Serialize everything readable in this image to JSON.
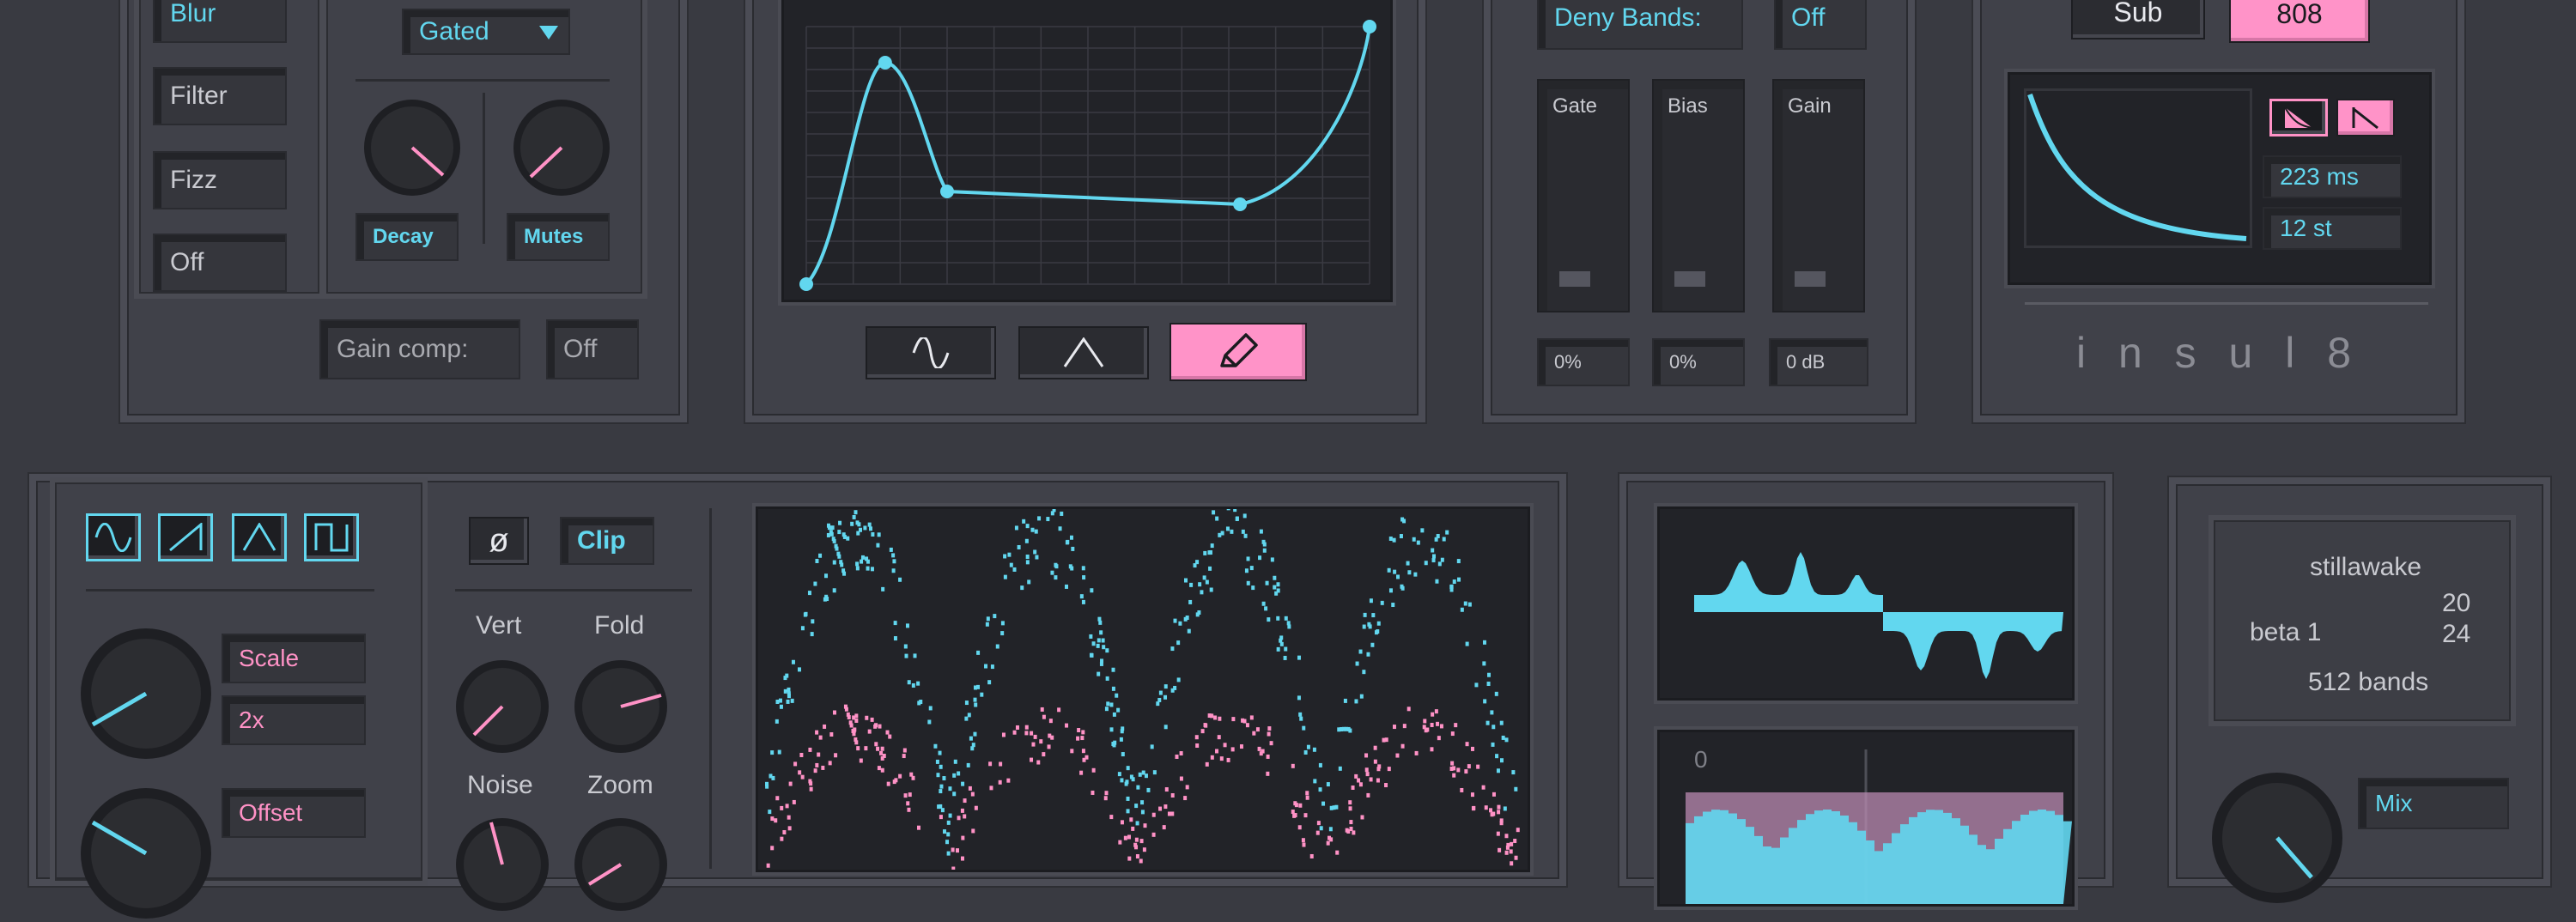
{
  "colors": {
    "cyan": "#62d7ef",
    "pink": "#ff92c6",
    "panel": "#404149",
    "screen": "#222328"
  },
  "mode_panel": {
    "items": [
      "Blur",
      "Filter",
      "Fizz",
      "Off"
    ],
    "gate_mode": "Gated",
    "knob_labels": [
      "Decay",
      "Mutes"
    ],
    "gain_comp_label": "Gain comp:",
    "gain_comp_value": "Off"
  },
  "curve_editor": {
    "tools": [
      "sine-icon",
      "triangle-icon",
      "pencil-icon"
    ],
    "points": [
      [
        0.0,
        0.0
      ],
      [
        0.14,
        0.86
      ],
      [
        0.25,
        0.36
      ],
      [
        0.77,
        0.31
      ],
      [
        1.0,
        1.0
      ]
    ]
  },
  "bands_panel": {
    "deny_label": "Deny Bands:",
    "deny_value": "Off",
    "faders": [
      {
        "label": "Gate",
        "value": "0%"
      },
      {
        "label": "Bias",
        "value": "0%"
      },
      {
        "label": "Gain",
        "value": "0 dB"
      }
    ]
  },
  "synth_panel": {
    "sub_label": "Sub",
    "preset_label": "808",
    "decay_value": "223 ms",
    "pitch_value": "12 st",
    "logo": "i n s u l 8"
  },
  "lfo_panel": {
    "waveforms": [
      "sine-wave-icon",
      "saw-wave-icon",
      "triangle-wave-icon",
      "square-wave-icon"
    ],
    "phase_symbol": "ø",
    "clip_label": "Clip",
    "scale_label": "Scale",
    "scale_value": "2x",
    "offset_label": "Offset",
    "knob_labels": {
      "vert": "Vert",
      "fold": "Fold",
      "noise": "Noise",
      "zoom": "Zoom"
    }
  },
  "spectrum_panel": {
    "zero_label": "0"
  },
  "info_panel": {
    "name": "stillawake",
    "version": "beta 1",
    "num_a": "20",
    "num_b": "24",
    "bands": "512 bands",
    "mix_label": "Mix"
  }
}
